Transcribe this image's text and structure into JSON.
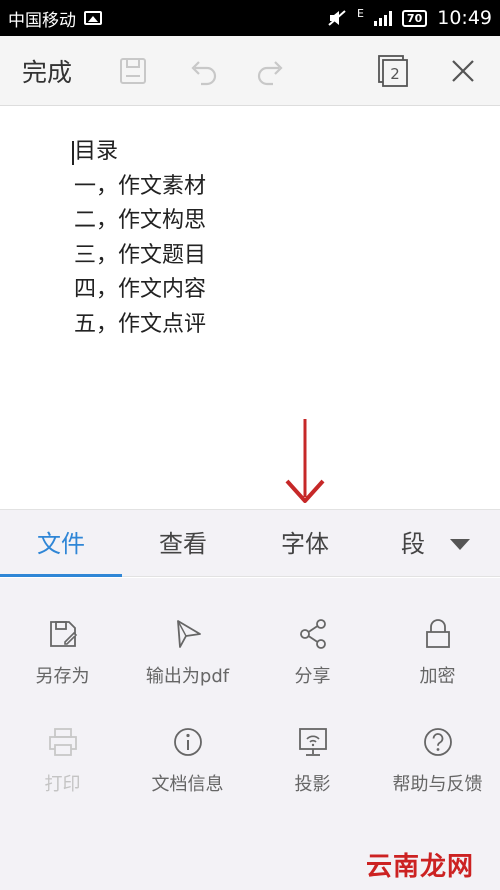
{
  "status_bar": {
    "carrier": "中国移动",
    "network": "E",
    "battery": "70",
    "time": "10:49"
  },
  "toolbar": {
    "done_label": "完成",
    "pages_count": "2"
  },
  "document": {
    "lines": [
      "目录",
      "一，作文素材",
      "二，作文构思",
      "三，作文题目",
      "四，作文内容",
      "五，作文点评"
    ],
    "arrow_color": "#c62828"
  },
  "tabs": [
    {
      "label": "文件",
      "active": true
    },
    {
      "label": "查看",
      "active": false
    },
    {
      "label": "字体",
      "active": false
    },
    {
      "label": "段",
      "active": false
    }
  ],
  "actions": [
    {
      "label": "另存为",
      "icon": "save-as-icon",
      "enabled": true
    },
    {
      "label": "输出为pdf",
      "icon": "export-pdf-icon",
      "enabled": true
    },
    {
      "label": "分享",
      "icon": "share-icon",
      "enabled": true
    },
    {
      "label": "加密",
      "icon": "lock-icon",
      "enabled": true
    },
    {
      "label": "打印",
      "icon": "print-icon",
      "enabled": false
    },
    {
      "label": "文档信息",
      "icon": "info-icon",
      "enabled": true
    },
    {
      "label": "投影",
      "icon": "projection-icon",
      "enabled": true
    },
    {
      "label": "帮助与反馈",
      "icon": "help-icon",
      "enabled": true
    }
  ],
  "watermark": "云南龙网",
  "colors": {
    "accent": "#2f86d6",
    "panel_bg": "#f3f2f6",
    "watermark": "#cc2222"
  }
}
